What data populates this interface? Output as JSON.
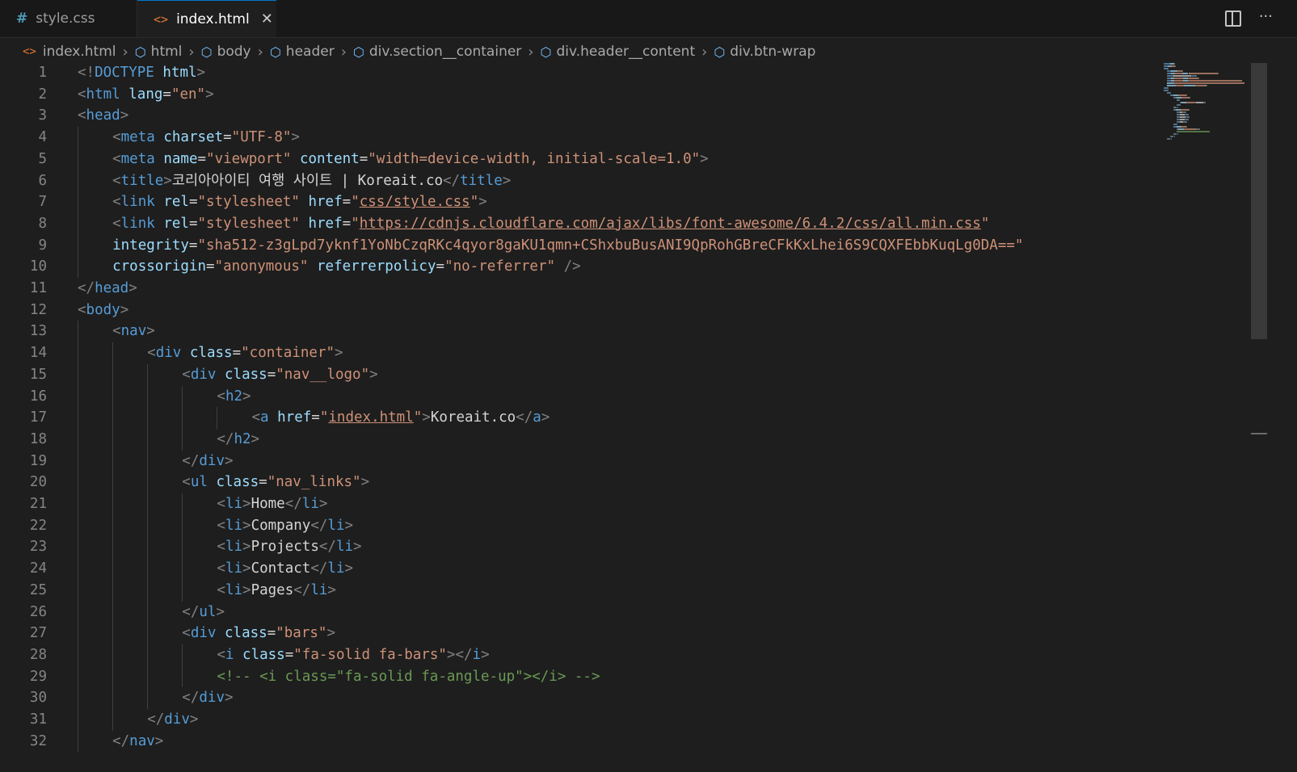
{
  "tabs": [
    {
      "label": "style.css",
      "icon": "hash-icon",
      "active": false
    },
    {
      "label": "index.html",
      "icon": "html-icon",
      "active": true
    }
  ],
  "toolbar": {
    "split_icon": "split-editor-icon",
    "more_label": "···"
  },
  "breadcrumb": [
    "index.html",
    "html",
    "body",
    "header",
    "div.section__container",
    "div.header__content",
    "div.btn-wrap"
  ],
  "lines": [
    {
      "n": "1",
      "indent": 0,
      "tokens": [
        [
          "t",
          "<!"
        ],
        [
          "tn",
          "DOCTYPE"
        ],
        [
          "tx",
          " "
        ],
        [
          "an",
          "html"
        ],
        [
          "t",
          ">"
        ]
      ]
    },
    {
      "n": "2",
      "indent": 0,
      "tokens": [
        [
          "t",
          "<"
        ],
        [
          "tn",
          "html"
        ],
        [
          "tx",
          " "
        ],
        [
          "an",
          "lang"
        ],
        [
          "tx",
          "="
        ],
        [
          "av",
          "\"en\""
        ],
        [
          "t",
          ">"
        ]
      ]
    },
    {
      "n": "3",
      "indent": 0,
      "tokens": [
        [
          "t",
          "<"
        ],
        [
          "tn",
          "head"
        ],
        [
          "t",
          ">"
        ]
      ]
    },
    {
      "n": "4",
      "indent": 1,
      "tokens": [
        [
          "t",
          "<"
        ],
        [
          "tn",
          "meta"
        ],
        [
          "tx",
          " "
        ],
        [
          "an",
          "charset"
        ],
        [
          "tx",
          "="
        ],
        [
          "av",
          "\"UTF-8\""
        ],
        [
          "t",
          ">"
        ]
      ]
    },
    {
      "n": "5",
      "indent": 1,
      "tokens": [
        [
          "t",
          "<"
        ],
        [
          "tn",
          "meta"
        ],
        [
          "tx",
          " "
        ],
        [
          "an",
          "name"
        ],
        [
          "tx",
          "="
        ],
        [
          "av",
          "\"viewport\""
        ],
        [
          "tx",
          " "
        ],
        [
          "an",
          "content"
        ],
        [
          "tx",
          "="
        ],
        [
          "av",
          "\"width=device-width, initial-scale=1.0\""
        ],
        [
          "t",
          ">"
        ]
      ]
    },
    {
      "n": "6",
      "indent": 1,
      "tokens": [
        [
          "t",
          "<"
        ],
        [
          "tn",
          "title"
        ],
        [
          "t",
          ">"
        ],
        [
          "tx",
          "코리아아이티 여행 사이트 | Koreait.co"
        ],
        [
          "t",
          "</"
        ],
        [
          "tn",
          "title"
        ],
        [
          "t",
          ">"
        ]
      ]
    },
    {
      "n": "7",
      "indent": 1,
      "tokens": [
        [
          "t",
          "<"
        ],
        [
          "tn",
          "link"
        ],
        [
          "tx",
          " "
        ],
        [
          "an",
          "rel"
        ],
        [
          "tx",
          "="
        ],
        [
          "av",
          "\"stylesheet\""
        ],
        [
          "tx",
          " "
        ],
        [
          "an",
          "href"
        ],
        [
          "tx",
          "="
        ],
        [
          "av",
          "\""
        ],
        [
          "avu",
          "css/style.css"
        ],
        [
          "av",
          "\""
        ],
        [
          "t",
          ">"
        ]
      ]
    },
    {
      "n": "8",
      "indent": 1,
      "tokens": [
        [
          "t",
          "<"
        ],
        [
          "tn",
          "link"
        ],
        [
          "tx",
          " "
        ],
        [
          "an",
          "rel"
        ],
        [
          "tx",
          "="
        ],
        [
          "av",
          "\"stylesheet\""
        ],
        [
          "tx",
          " "
        ],
        [
          "an",
          "href"
        ],
        [
          "tx",
          "="
        ],
        [
          "av",
          "\""
        ],
        [
          "avu",
          "https://cdnjs.cloudflare.com/ajax/libs/font-awesome/6.4.2/css/all.min.css"
        ],
        [
          "av",
          "\""
        ]
      ]
    },
    {
      "n": "9",
      "indent": 1,
      "tokens": [
        [
          "an",
          "integrity"
        ],
        [
          "tx",
          "="
        ],
        [
          "av",
          "\"sha512-z3gLpd7yknf1YoNbCzqRKc4qyor8gaKU1qmn+CShxbuBusANI9QpRohGBreCFkKxLhei6S9CQXFEbbKuqLg0DA==\""
        ]
      ]
    },
    {
      "n": "10",
      "indent": 1,
      "tokens": [
        [
          "an",
          "crossorigin"
        ],
        [
          "tx",
          "="
        ],
        [
          "av",
          "\"anonymous\""
        ],
        [
          "tx",
          " "
        ],
        [
          "an",
          "referrerpolicy"
        ],
        [
          "tx",
          "="
        ],
        [
          "av",
          "\"no-referrer\""
        ],
        [
          "tx",
          " "
        ],
        [
          "t",
          "/>"
        ]
      ]
    },
    {
      "n": "11",
      "indent": 0,
      "tokens": [
        [
          "t",
          "</"
        ],
        [
          "tn",
          "head"
        ],
        [
          "t",
          ">"
        ]
      ]
    },
    {
      "n": "12",
      "indent": 0,
      "tokens": [
        [
          "t",
          "<"
        ],
        [
          "tn",
          "body"
        ],
        [
          "t",
          ">"
        ]
      ]
    },
    {
      "n": "13",
      "indent": 1,
      "tokens": [
        [
          "t",
          "<"
        ],
        [
          "tn",
          "nav"
        ],
        [
          "t",
          ">"
        ]
      ]
    },
    {
      "n": "14",
      "indent": 2,
      "tokens": [
        [
          "t",
          "<"
        ],
        [
          "tn",
          "div"
        ],
        [
          "tx",
          " "
        ],
        [
          "an",
          "class"
        ],
        [
          "tx",
          "="
        ],
        [
          "av",
          "\"container\""
        ],
        [
          "t",
          ">"
        ]
      ]
    },
    {
      "n": "15",
      "indent": 3,
      "tokens": [
        [
          "t",
          "<"
        ],
        [
          "tn",
          "div"
        ],
        [
          "tx",
          " "
        ],
        [
          "an",
          "class"
        ],
        [
          "tx",
          "="
        ],
        [
          "av",
          "\"nav__logo\""
        ],
        [
          "t",
          ">"
        ]
      ]
    },
    {
      "n": "16",
      "indent": 4,
      "tokens": [
        [
          "t",
          "<"
        ],
        [
          "tn",
          "h2"
        ],
        [
          "t",
          ">"
        ]
      ]
    },
    {
      "n": "17",
      "indent": 5,
      "tokens": [
        [
          "t",
          "<"
        ],
        [
          "tn",
          "a"
        ],
        [
          "tx",
          " "
        ],
        [
          "an",
          "href"
        ],
        [
          "tx",
          "="
        ],
        [
          "av",
          "\""
        ],
        [
          "avu",
          "index.html"
        ],
        [
          "av",
          "\""
        ],
        [
          "t",
          ">"
        ],
        [
          "tx",
          "Koreait.co"
        ],
        [
          "t",
          "</"
        ],
        [
          "tn",
          "a"
        ],
        [
          "t",
          ">"
        ]
      ]
    },
    {
      "n": "18",
      "indent": 4,
      "tokens": [
        [
          "t",
          "</"
        ],
        [
          "tn",
          "h2"
        ],
        [
          "t",
          ">"
        ]
      ]
    },
    {
      "n": "19",
      "indent": 3,
      "tokens": [
        [
          "t",
          "</"
        ],
        [
          "tn",
          "div"
        ],
        [
          "t",
          ">"
        ]
      ]
    },
    {
      "n": "20",
      "indent": 3,
      "tokens": [
        [
          "t",
          "<"
        ],
        [
          "tn",
          "ul"
        ],
        [
          "tx",
          " "
        ],
        [
          "an",
          "class"
        ],
        [
          "tx",
          "="
        ],
        [
          "av",
          "\"nav_links\""
        ],
        [
          "t",
          ">"
        ]
      ]
    },
    {
      "n": "21",
      "indent": 4,
      "tokens": [
        [
          "t",
          "<"
        ],
        [
          "tn",
          "li"
        ],
        [
          "t",
          ">"
        ],
        [
          "tx",
          "Home"
        ],
        [
          "t",
          "</"
        ],
        [
          "tn",
          "li"
        ],
        [
          "t",
          ">"
        ]
      ]
    },
    {
      "n": "22",
      "indent": 4,
      "tokens": [
        [
          "t",
          "<"
        ],
        [
          "tn",
          "li"
        ],
        [
          "t",
          ">"
        ],
        [
          "tx",
          "Company"
        ],
        [
          "t",
          "</"
        ],
        [
          "tn",
          "li"
        ],
        [
          "t",
          ">"
        ]
      ]
    },
    {
      "n": "23",
      "indent": 4,
      "tokens": [
        [
          "t",
          "<"
        ],
        [
          "tn",
          "li"
        ],
        [
          "t",
          ">"
        ],
        [
          "tx",
          "Projects"
        ],
        [
          "t",
          "</"
        ],
        [
          "tn",
          "li"
        ],
        [
          "t",
          ">"
        ]
      ]
    },
    {
      "n": "24",
      "indent": 4,
      "tokens": [
        [
          "t",
          "<"
        ],
        [
          "tn",
          "li"
        ],
        [
          "t",
          ">"
        ],
        [
          "tx",
          "Contact"
        ],
        [
          "t",
          "</"
        ],
        [
          "tn",
          "li"
        ],
        [
          "t",
          ">"
        ]
      ]
    },
    {
      "n": "25",
      "indent": 4,
      "tokens": [
        [
          "t",
          "<"
        ],
        [
          "tn",
          "li"
        ],
        [
          "t",
          ">"
        ],
        [
          "tx",
          "Pages"
        ],
        [
          "t",
          "</"
        ],
        [
          "tn",
          "li"
        ],
        [
          "t",
          ">"
        ]
      ]
    },
    {
      "n": "26",
      "indent": 3,
      "tokens": [
        [
          "t",
          "</"
        ],
        [
          "tn",
          "ul"
        ],
        [
          "t",
          ">"
        ]
      ]
    },
    {
      "n": "27",
      "indent": 3,
      "tokens": [
        [
          "t",
          "<"
        ],
        [
          "tn",
          "div"
        ],
        [
          "tx",
          " "
        ],
        [
          "an",
          "class"
        ],
        [
          "tx",
          "="
        ],
        [
          "av",
          "\"bars\""
        ],
        [
          "t",
          ">"
        ]
      ]
    },
    {
      "n": "28",
      "indent": 4,
      "tokens": [
        [
          "t",
          "<"
        ],
        [
          "tn",
          "i"
        ],
        [
          "tx",
          " "
        ],
        [
          "an",
          "class"
        ],
        [
          "tx",
          "="
        ],
        [
          "av",
          "\"fa-solid fa-bars\""
        ],
        [
          "t",
          "></"
        ],
        [
          "tn",
          "i"
        ],
        [
          "t",
          ">"
        ]
      ]
    },
    {
      "n": "29",
      "indent": 4,
      "tokens": [
        [
          "cm",
          "<!-- <i class=\"fa-solid fa-angle-up\"></i> -->"
        ]
      ]
    },
    {
      "n": "30",
      "indent": 3,
      "tokens": [
        [
          "t",
          "</"
        ],
        [
          "tn",
          "div"
        ],
        [
          "t",
          ">"
        ]
      ]
    },
    {
      "n": "31",
      "indent": 2,
      "tokens": [
        [
          "t",
          "</"
        ],
        [
          "tn",
          "div"
        ],
        [
          "t",
          ">"
        ]
      ]
    },
    {
      "n": "32",
      "indent": 1,
      "tokens": [
        [
          "t",
          "</"
        ],
        [
          "tn",
          "nav"
        ],
        [
          "t",
          ">"
        ]
      ]
    }
  ],
  "colors": {
    "background": "#1e1e1e",
    "tag": "#569cd6",
    "attribute": "#9cdcfe",
    "string": "#ce9178",
    "comment": "#6a9955",
    "punctuation": "#808080"
  }
}
